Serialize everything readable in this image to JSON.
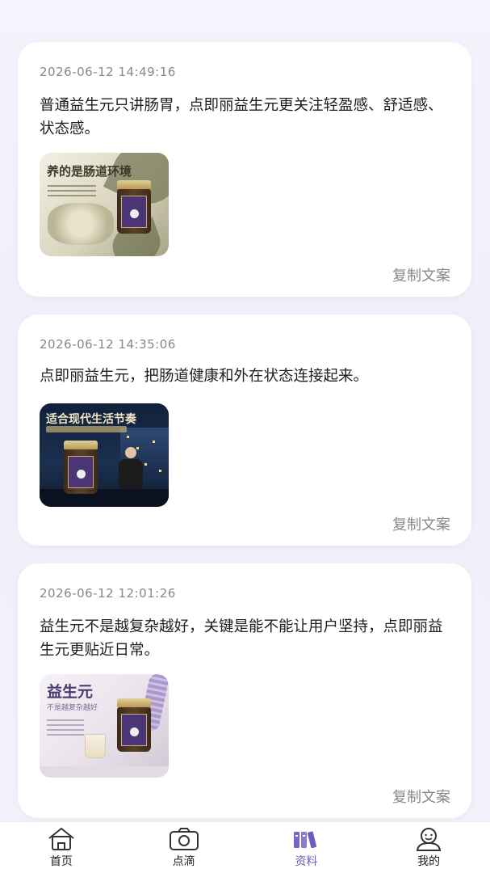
{
  "posts": [
    {
      "timestamp": "2026-06-12 14:49:16",
      "text": "普通益生元只讲肠胃，点即丽益生元更关注轻盈感、舒适感、状态感。",
      "image_title": "养的是肠道环境",
      "copy_label": "复制文案"
    },
    {
      "timestamp": "2026-06-12 14:35:06",
      "text": "点即丽益生元，把肠道健康和外在状态连接起来。",
      "image_title": "适合现代生活节奏",
      "copy_label": "复制文案"
    },
    {
      "timestamp": "2026-06-12 12:01:26",
      "text": "益生元不是越复杂越好，关键是能不能让用户坚持，点即丽益生元更贴近日常。",
      "image_title": "益生元",
      "image_subtitle": "不是越复杂越好",
      "copy_label": "复制文案"
    }
  ],
  "tabbar": {
    "items": [
      {
        "label": "首页",
        "icon": "home-icon"
      },
      {
        "label": "点滴",
        "icon": "camera-icon"
      },
      {
        "label": "资料",
        "icon": "books-icon",
        "active": true
      },
      {
        "label": "我的",
        "icon": "user-icon"
      }
    ],
    "active_color": "#6e5bc0"
  }
}
